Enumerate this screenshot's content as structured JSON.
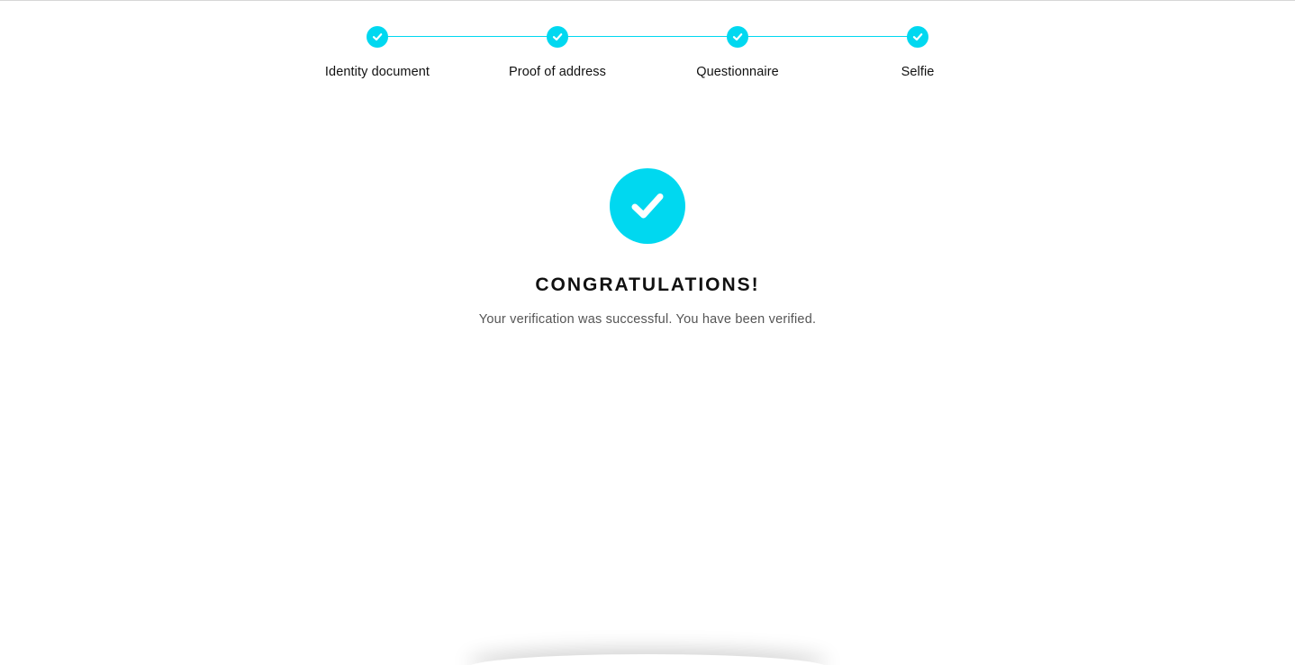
{
  "colors": {
    "accent": "#00d8f0",
    "text_primary": "#111111",
    "text_secondary": "#555555"
  },
  "stepper": {
    "steps": [
      {
        "label": "Identity document",
        "status": "completed",
        "icon": "check-icon"
      },
      {
        "label": "Proof of address",
        "status": "completed",
        "icon": "check-icon"
      },
      {
        "label": "Questionnaire",
        "status": "completed",
        "icon": "check-icon"
      },
      {
        "label": "Selfie",
        "status": "completed",
        "icon": "check-icon"
      }
    ]
  },
  "result": {
    "icon": "check-circle-icon",
    "title": "CONGRATULATIONS!",
    "message": "Your verification was successful. You have been verified."
  }
}
